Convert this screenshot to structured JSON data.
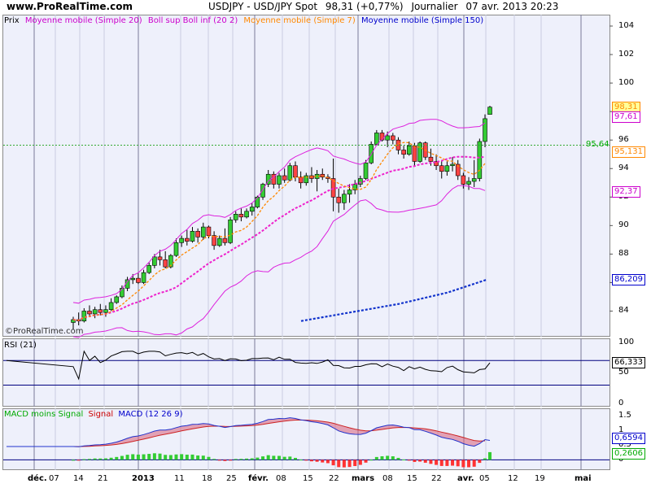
{
  "header": {
    "site": "www.ProRealTime.com",
    "symbol": "USDJPY - USD/JPY Spot",
    "price": "98,31 (+0,77%)",
    "period": "Journalier",
    "date": "07 avr. 2013 20:23",
    "watermark": "©ProRealTime.com"
  },
  "legend": [
    {
      "text": "Prix",
      "color": "#000000"
    },
    {
      "text": "Moyenne mobile (Simple 20)",
      "color": "#cc00cc"
    },
    {
      "text": "Boll sup Boll inf (20 2)",
      "color": "#cc00cc"
    },
    {
      "text": "Moyenne mobile (Simple 7)",
      "color": "#ff8800"
    },
    {
      "text": "Moyenne mobile (Simple 150)",
      "color": "#0000cc"
    }
  ],
  "rsi_label": "RSI (21)",
  "macd_labels": [
    {
      "text": "MACD moins Signal",
      "color": "#00aa00"
    },
    {
      "text": "Signal",
      "color": "#cc0000"
    },
    {
      "text": "MACD (12 26 9)",
      "color": "#0000cc"
    }
  ],
  "price_tags": [
    {
      "text": "98,31",
      "price": 98.31,
      "color": "#ff8800",
      "bg": "#ffff99"
    },
    {
      "text": "97,61",
      "price": 97.61,
      "color": "#cc00cc",
      "bg": "#ffffff"
    },
    {
      "text": "95,64",
      "price": 95.64,
      "color": "#00aa00",
      "bg": "none"
    },
    {
      "text": "95,131",
      "price": 95.131,
      "color": "#ff8800",
      "bg": "#ffffff"
    },
    {
      "text": "92,37",
      "price": 92.37,
      "color": "#cc00cc",
      "bg": "#ffffff"
    },
    {
      "text": "86,209",
      "price": 86.209,
      "color": "#0000cc",
      "bg": "#ffffff"
    }
  ],
  "rsi_tag": {
    "text": "66,333",
    "value": 66.333,
    "color": "#000000"
  },
  "macd_tags": [
    {
      "text": "0,6594",
      "value": 0.6594,
      "color": "#0000cc"
    },
    {
      "text": "0,2606",
      "value": 0.2606,
      "color": "#00aa00"
    }
  ],
  "chart_data": {
    "type": "candlestick",
    "price_axis": {
      "ticks": [
        84,
        86,
        88,
        90,
        92,
        94,
        96,
        98,
        100,
        102,
        104
      ],
      "labels": [
        "84",
        "",
        "88",
        "90",
        "92",
        "94",
        "96",
        "",
        "100",
        "102",
        "104"
      ],
      "ylim": [
        82.2,
        104.8
      ]
    },
    "rsi_axis": {
      "ticks": [
        0,
        50,
        70,
        100
      ],
      "labels": [
        "0",
        "50",
        "",
        "100"
      ],
      "ylim": [
        -5,
        106
      ],
      "levels": [
        30,
        70
      ]
    },
    "macd_axis": {
      "ticks": [
        0,
        0.5,
        1,
        1.5
      ],
      "labels": [
        "0",
        "0.5",
        "1",
        "1.5"
      ],
      "ylim": [
        -0.35,
        1.75
      ]
    },
    "x_labels": [
      "déc.",
      "07",
      "14",
      "21",
      "2013",
      "11",
      "18",
      "25",
      "févr.",
      "08",
      "15",
      "22",
      "mars",
      "08",
      "15",
      "22",
      "avr.",
      "05",
      "12",
      "19",
      "mai"
    ],
    "candles": [
      {
        "o": 83.2,
        "h": 83.6,
        "l": 82.7,
        "c": 83.4
      },
      {
        "o": 83.4,
        "h": 83.9,
        "l": 83.0,
        "c": 83.3
      },
      {
        "o": 83.3,
        "h": 84.2,
        "l": 83.2,
        "c": 84.0
      },
      {
        "o": 84.0,
        "h": 84.4,
        "l": 83.6,
        "c": 83.8
      },
      {
        "o": 83.8,
        "h": 84.3,
        "l": 83.5,
        "c": 84.1
      },
      {
        "o": 84.1,
        "h": 84.5,
        "l": 83.7,
        "c": 83.9
      },
      {
        "o": 83.9,
        "h": 84.4,
        "l": 83.6,
        "c": 84.1
      },
      {
        "o": 84.1,
        "h": 84.9,
        "l": 84.0,
        "c": 84.6
      },
      {
        "o": 84.6,
        "h": 85.1,
        "l": 84.5,
        "c": 85.0
      },
      {
        "o": 85.0,
        "h": 85.8,
        "l": 84.9,
        "c": 85.6
      },
      {
        "o": 85.6,
        "h": 86.4,
        "l": 85.4,
        "c": 86.2
      },
      {
        "o": 86.2,
        "h": 86.6,
        "l": 85.9,
        "c": 86.3
      },
      {
        "o": 86.3,
        "h": 86.7,
        "l": 85.9,
        "c": 86.0
      },
      {
        "o": 86.0,
        "h": 86.9,
        "l": 85.9,
        "c": 86.7
      },
      {
        "o": 86.7,
        "h": 87.4,
        "l": 86.6,
        "c": 87.2
      },
      {
        "o": 87.2,
        "h": 88.0,
        "l": 87.0,
        "c": 87.8
      },
      {
        "o": 87.8,
        "h": 88.3,
        "l": 87.2,
        "c": 87.6
      },
      {
        "o": 87.6,
        "h": 88.2,
        "l": 87.0,
        "c": 87.1
      },
      {
        "o": 87.1,
        "h": 88.0,
        "l": 87.0,
        "c": 87.9
      },
      {
        "o": 87.9,
        "h": 89.1,
        "l": 87.8,
        "c": 88.8
      },
      {
        "o": 88.8,
        "h": 89.3,
        "l": 88.5,
        "c": 89.1
      },
      {
        "o": 89.1,
        "h": 89.7,
        "l": 88.6,
        "c": 88.9
      },
      {
        "o": 88.9,
        "h": 89.9,
        "l": 88.8,
        "c": 89.6
      },
      {
        "o": 89.6,
        "h": 89.8,
        "l": 88.8,
        "c": 89.2
      },
      {
        "o": 89.2,
        "h": 90.2,
        "l": 89.0,
        "c": 89.9
      },
      {
        "o": 89.9,
        "h": 90.0,
        "l": 89.1,
        "c": 89.3
      },
      {
        "o": 89.3,
        "h": 89.6,
        "l": 88.3,
        "c": 88.6
      },
      {
        "o": 88.6,
        "h": 89.3,
        "l": 88.5,
        "c": 89.1
      },
      {
        "o": 89.1,
        "h": 89.8,
        "l": 88.6,
        "c": 88.8
      },
      {
        "o": 88.8,
        "h": 90.6,
        "l": 88.7,
        "c": 90.4
      },
      {
        "o": 90.4,
        "h": 91.0,
        "l": 90.2,
        "c": 90.8
      },
      {
        "o": 90.8,
        "h": 91.2,
        "l": 90.3,
        "c": 90.6
      },
      {
        "o": 90.6,
        "h": 91.2,
        "l": 90.5,
        "c": 91.0
      },
      {
        "o": 91.0,
        "h": 91.6,
        "l": 90.7,
        "c": 91.3
      },
      {
        "o": 91.3,
        "h": 92.1,
        "l": 91.2,
        "c": 92.0
      },
      {
        "o": 92.0,
        "h": 93.0,
        "l": 91.8,
        "c": 92.9
      },
      {
        "o": 92.9,
        "h": 93.9,
        "l": 92.7,
        "c": 93.6
      },
      {
        "o": 93.6,
        "h": 93.8,
        "l": 92.6,
        "c": 92.9
      },
      {
        "o": 92.9,
        "h": 93.7,
        "l": 92.6,
        "c": 93.5
      },
      {
        "o": 93.5,
        "h": 94.0,
        "l": 93.0,
        "c": 93.2
      },
      {
        "o": 93.2,
        "h": 94.4,
        "l": 93.1,
        "c": 94.2
      },
      {
        "o": 94.2,
        "h": 94.5,
        "l": 93.1,
        "c": 93.4
      },
      {
        "o": 93.4,
        "h": 93.8,
        "l": 92.6,
        "c": 93.0
      },
      {
        "o": 93.0,
        "h": 93.7,
        "l": 92.8,
        "c": 93.5
      },
      {
        "o": 93.5,
        "h": 94.1,
        "l": 93.0,
        "c": 93.3
      },
      {
        "o": 93.3,
        "h": 93.9,
        "l": 92.4,
        "c": 93.6
      },
      {
        "o": 93.6,
        "h": 94.0,
        "l": 93.2,
        "c": 93.4
      },
      {
        "o": 93.4,
        "h": 93.6,
        "l": 93.0,
        "c": 93.3
      },
      {
        "o": 93.3,
        "h": 94.7,
        "l": 91.0,
        "c": 92.0
      },
      {
        "o": 92.0,
        "h": 92.6,
        "l": 90.9,
        "c": 91.6
      },
      {
        "o": 91.6,
        "h": 92.5,
        "l": 91.1,
        "c": 92.2
      },
      {
        "o": 92.2,
        "h": 92.9,
        "l": 91.6,
        "c": 92.5
      },
      {
        "o": 92.5,
        "h": 93.2,
        "l": 92.2,
        "c": 92.9
      },
      {
        "o": 92.9,
        "h": 93.5,
        "l": 92.7,
        "c": 93.3
      },
      {
        "o": 93.3,
        "h": 94.6,
        "l": 93.2,
        "c": 94.4
      },
      {
        "o": 94.4,
        "h": 95.9,
        "l": 94.3,
        "c": 95.7
      },
      {
        "o": 95.7,
        "h": 96.7,
        "l": 95.6,
        "c": 96.5
      },
      {
        "o": 96.5,
        "h": 96.7,
        "l": 95.9,
        "c": 96.0
      },
      {
        "o": 96.0,
        "h": 96.6,
        "l": 95.5,
        "c": 96.3
      },
      {
        "o": 96.3,
        "h": 96.5,
        "l": 95.7,
        "c": 96.0
      },
      {
        "o": 96.0,
        "h": 96.2,
        "l": 95.0,
        "c": 95.3
      },
      {
        "o": 95.3,
        "h": 95.6,
        "l": 94.7,
        "c": 95.0
      },
      {
        "o": 95.0,
        "h": 95.9,
        "l": 94.9,
        "c": 95.6
      },
      {
        "o": 95.6,
        "h": 95.8,
        "l": 94.2,
        "c": 94.5
      },
      {
        "o": 94.5,
        "h": 95.9,
        "l": 94.4,
        "c": 95.8
      },
      {
        "o": 95.8,
        "h": 95.9,
        "l": 94.6,
        "c": 94.8
      },
      {
        "o": 94.8,
        "h": 95.4,
        "l": 94.2,
        "c": 94.5
      },
      {
        "o": 94.5,
        "h": 95.0,
        "l": 93.9,
        "c": 94.2
      },
      {
        "o": 94.2,
        "h": 94.6,
        "l": 93.3,
        "c": 93.8
      },
      {
        "o": 93.8,
        "h": 94.5,
        "l": 93.5,
        "c": 94.2
      },
      {
        "o": 94.2,
        "h": 94.8,
        "l": 93.8,
        "c": 94.3
      },
      {
        "o": 94.3,
        "h": 94.6,
        "l": 93.2,
        "c": 93.5
      },
      {
        "o": 93.5,
        "h": 93.7,
        "l": 92.6,
        "c": 92.9
      },
      {
        "o": 92.9,
        "h": 93.4,
        "l": 92.5,
        "c": 93.1
      },
      {
        "o": 93.1,
        "h": 94.6,
        "l": 92.7,
        "c": 93.3
      },
      {
        "o": 93.3,
        "h": 96.1,
        "l": 93.1,
        "c": 95.9
      },
      {
        "o": 95.9,
        "h": 97.8,
        "l": 95.5,
        "c": 97.5
      }
    ],
    "last": {
      "o": 97.8,
      "h": 98.4,
      "l": 97.8,
      "c": 98.31
    }
  }
}
